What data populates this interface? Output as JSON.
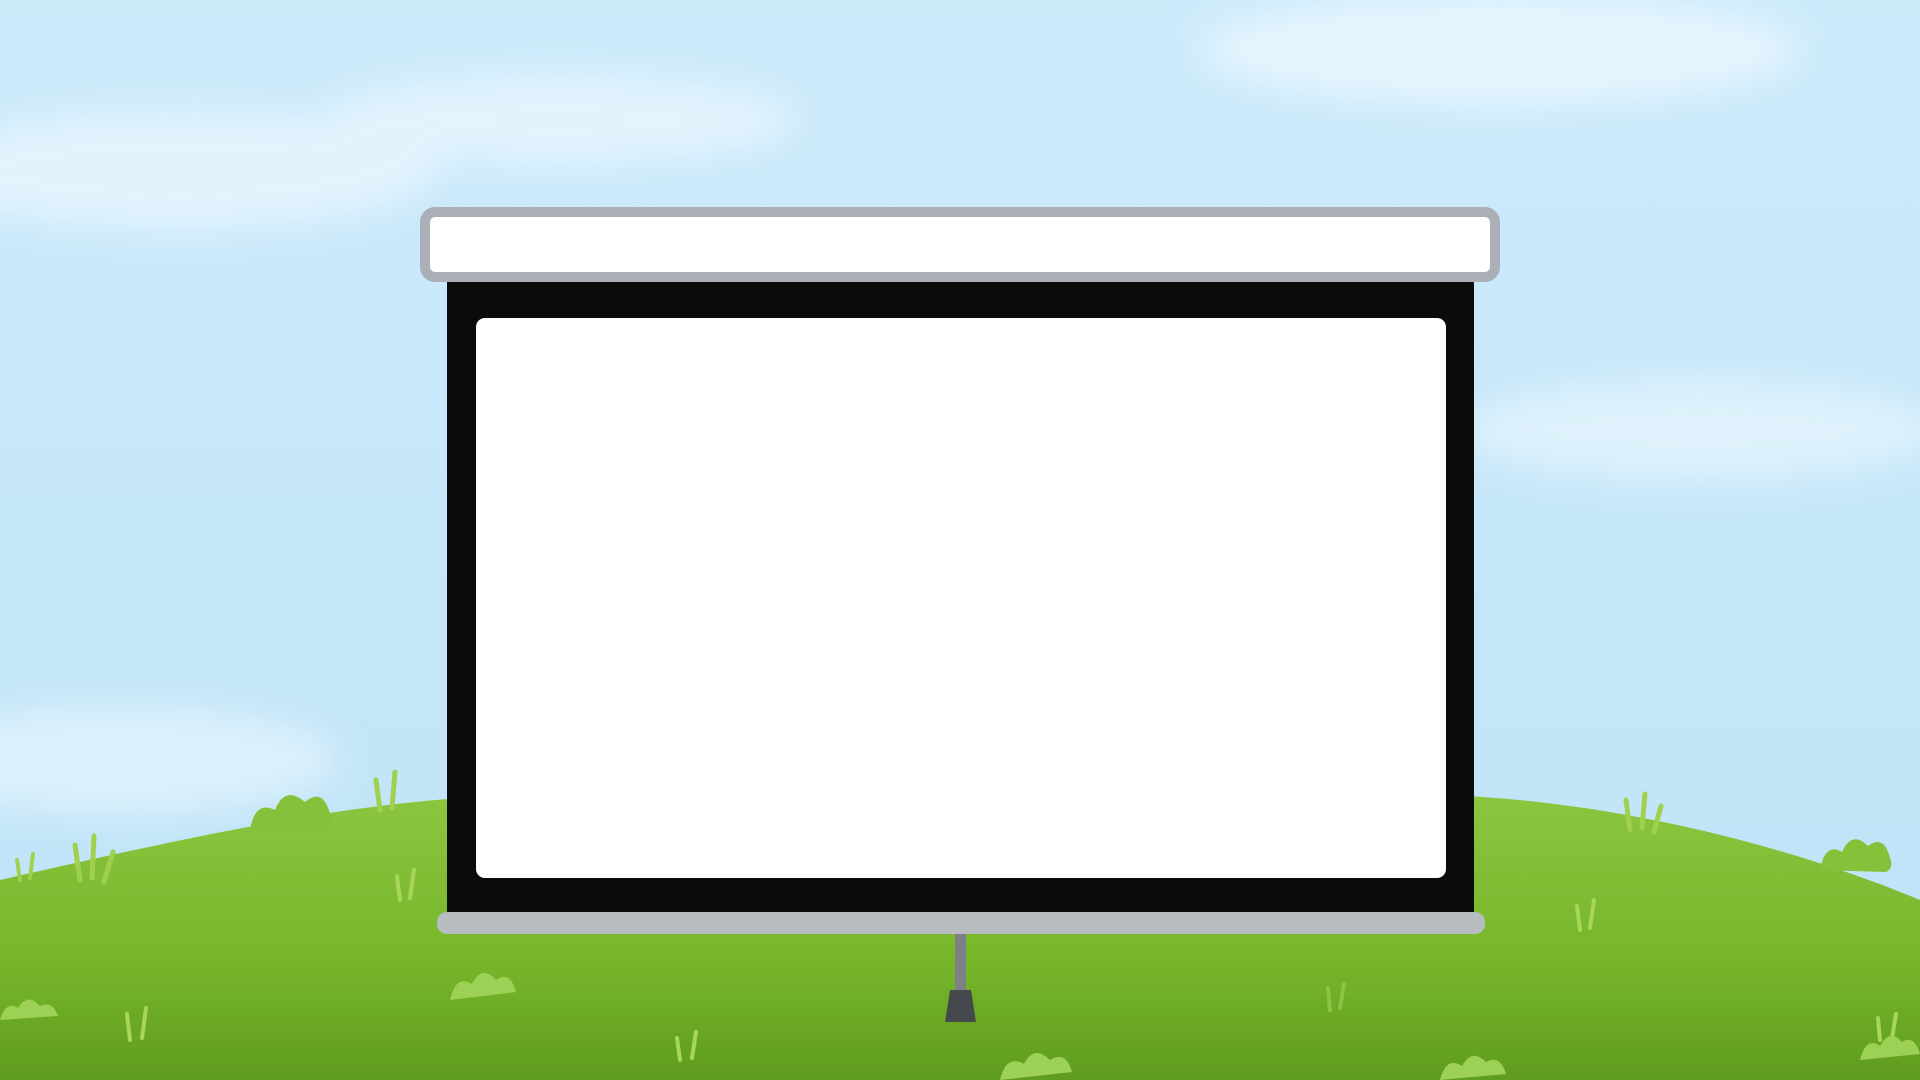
{
  "scene": {
    "description_free": true,
    "colors": {
      "sky_top": "#cdeafb",
      "sky_bottom": "#bfe3f7",
      "cloud": "#e9f6fd",
      "grass_light": "#8cc63f",
      "grass_mid": "#76b52a",
      "grass_dark": "#5f9c1f",
      "grass_blade": "#a8d65a",
      "screen_frame": "#0b0b0b",
      "screen_surface": "#ffffff",
      "roller_fill": "#ffffff",
      "roller_border": "#aab0b6",
      "bottom_bar": "#b7bcc1",
      "stand_pole": "#7b8187",
      "stand_foot": "#45494d"
    },
    "icons": {
      "screen": "projector-screen-icon",
      "roller": "screen-roller-icon",
      "stand": "tripod-stand-icon"
    }
  }
}
